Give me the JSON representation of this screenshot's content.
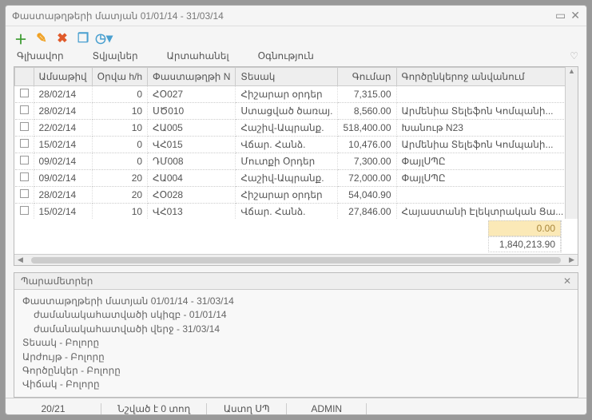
{
  "window": {
    "title": "Փաստաթղթերի մատյան 01/01/14 - 31/03/14"
  },
  "menu": {
    "main": "Գլխավոր",
    "data": "Տվյալներ",
    "export": "Արտահանել",
    "help": "Օգնություն"
  },
  "columns": {
    "c0": "",
    "c1": "Ամսաթիվ",
    "c2": "Օրվա h/h",
    "c3": "Փաստաթղթի N",
    "c4": "Տեսակ",
    "c5": "Գումար",
    "c6": "Գործընկերոջ անվանում"
  },
  "rows": [
    {
      "date": "28/02/14",
      "dayhh": "0",
      "docn": "ՀՕ027",
      "type": "Հիշարար օրդեր",
      "amount": "7,315.00",
      "partner": ""
    },
    {
      "date": "28/02/14",
      "dayhh": "10",
      "docn": "ՍԾ010",
      "type": "Ստացված ծառայ.",
      "amount": "8,560.00",
      "partner": "Արմենիա Տելեֆոն Կոմպանի..."
    },
    {
      "date": "22/02/14",
      "dayhh": "10",
      "docn": "ՀԱ005",
      "type": "Հաշիվ-Ապրանք.",
      "amount": "518,400.00",
      "partner": "Խանութ N23"
    },
    {
      "date": "15/02/14",
      "dayhh": "0",
      "docn": "ՎՀ015",
      "type": "Վճար. Հանձ.",
      "amount": "10,476.00",
      "partner": "Արմենիա Տելեֆոն Կոմպանի..."
    },
    {
      "date": "09/02/14",
      "dayhh": "0",
      "docn": "ԴՄ008",
      "type": "Մուտքի Օրդեր",
      "amount": "7,300.00",
      "partner": "ՓայլՍՊԸ"
    },
    {
      "date": "09/02/14",
      "dayhh": "20",
      "docn": "ՀԱ004",
      "type": "Հաշիվ-Ապրանք.",
      "amount": "72,000.00",
      "partner": "ՓայլՍՊԸ"
    },
    {
      "date": "28/02/14",
      "dayhh": "20",
      "docn": "ՀՕ028",
      "type": "Հիշարար օրդեր",
      "amount": "54,040.90",
      "partner": ""
    },
    {
      "date": "15/02/14",
      "dayhh": "10",
      "docn": "ՎՀ013",
      "type": "Վճար. Հանձ.",
      "amount": "27,846.00",
      "partner": "Հայաստանի Էլեկտրական Ցա..."
    }
  ],
  "totals": {
    "selected": "0.00",
    "grand": "1,840,213.90"
  },
  "params": {
    "title": "Պարամետրեր",
    "l1": "Փաստաթղթերի մատյան 01/01/14 - 31/03/14",
    "l2": "ժամանակահատվածի սկիզբ  - 01/01/14",
    "l3": "ժամանակահատվածի վերջ  - 31/03/14",
    "l4": "Տեսակ  - Բոլորը",
    "l5": "Արժույթ  - Բոլորը",
    "l6": "Գործընկեր  - Բոլորը",
    "l7": "Վիճակ  - Բոլորը"
  },
  "status": {
    "pos": "20/21",
    "lines": "Նշված է 0 տող",
    "org": "Աստղ ՍՊ",
    "user": "ADMIN"
  }
}
